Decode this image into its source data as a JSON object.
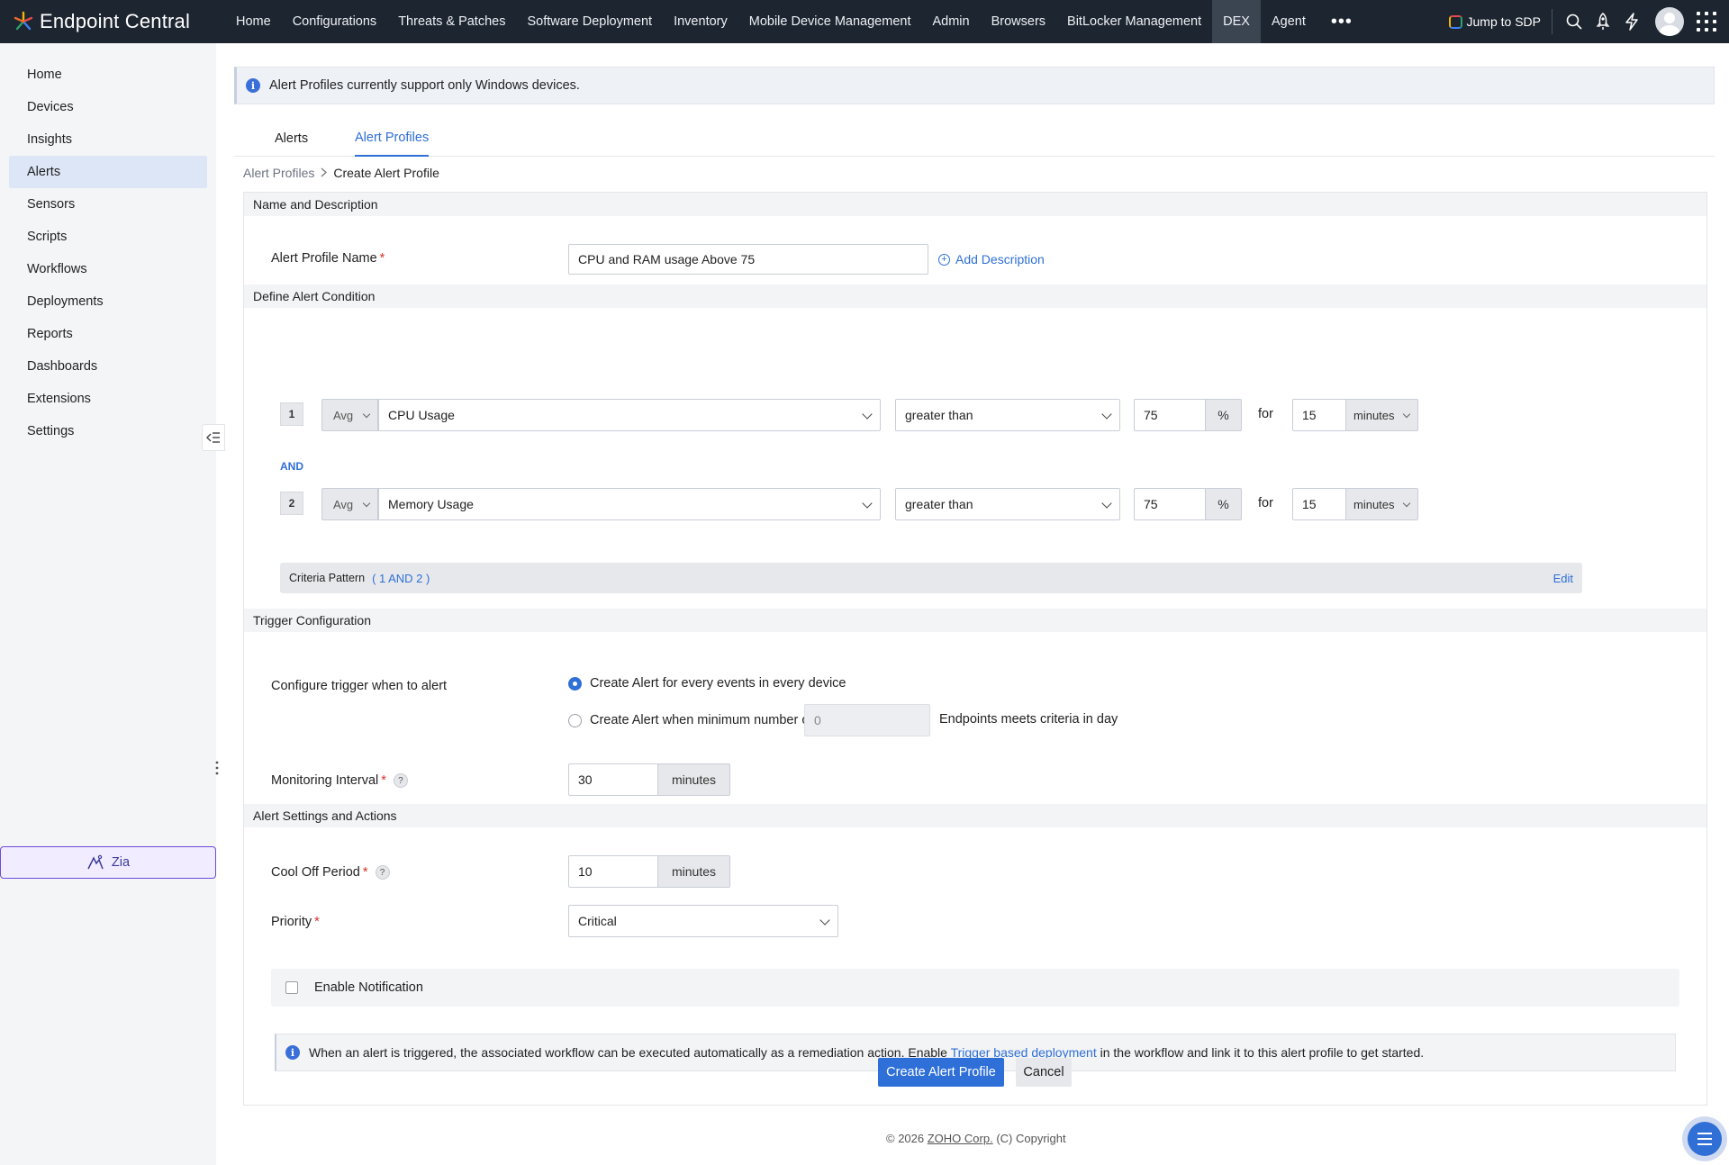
{
  "app": {
    "title": "Endpoint Central"
  },
  "topnav": {
    "items": [
      "Home",
      "Configurations",
      "Threats & Patches",
      "Software Deployment",
      "Inventory",
      "Mobile Device Management",
      "Admin",
      "Browsers",
      "BitLocker Management",
      "DEX",
      "Agent"
    ],
    "active": "DEX",
    "more": "•••",
    "jump_label": "Jump to SDP",
    "icons": [
      "search-icon",
      "rocket-icon",
      "lightning-icon",
      "avatar",
      "app-grid-icon"
    ]
  },
  "sidebar": {
    "items": [
      "Home",
      "Devices",
      "Insights",
      "Alerts",
      "Sensors",
      "Scripts",
      "Workflows",
      "Deployments",
      "Reports",
      "Dashboards",
      "Extensions",
      "Settings"
    ],
    "active": "Alerts",
    "zia_label": "Zia"
  },
  "banner": {
    "text": "Alert Profiles currently support only Windows devices."
  },
  "tabs": {
    "alerts": "Alerts",
    "alert_profiles": "Alert Profiles",
    "active": "Alert Profiles"
  },
  "breadcrumb": {
    "parent": "Alert Profiles",
    "current": "Create Alert Profile"
  },
  "sections": {
    "name": "Name and Description",
    "condition": "Define Alert Condition",
    "trigger": "Trigger Configuration",
    "settings": "Alert Settings and Actions"
  },
  "name_section": {
    "label": "Alert Profile Name",
    "value": "CPU and RAM usage Above 75",
    "add_description": "Add Description"
  },
  "conditions": [
    {
      "num": "1",
      "agg": "Avg",
      "metric": "CPU Usage",
      "operator": "greater than",
      "value": "75",
      "unit": "%",
      "for": "for",
      "duration": "15",
      "duration_unit": "minutes"
    },
    {
      "num": "2",
      "agg": "Avg",
      "metric": "Memory Usage",
      "operator": "greater than",
      "value": "75",
      "unit": "%",
      "for": "for",
      "duration": "15",
      "duration_unit": "minutes"
    }
  ],
  "and_label": "AND",
  "criteria": {
    "label": "Criteria Pattern",
    "pattern": "( 1 AND 2 )",
    "edit": "Edit"
  },
  "trigger": {
    "label": "Configure trigger when to alert",
    "option1": "Create Alert for every events in every device",
    "option2_prefix": "Create Alert when minimum number of",
    "option2_value": "0",
    "option2_suffix": "Endpoints meets criteria in day",
    "selected": "option1",
    "interval_label": "Monitoring Interval",
    "interval_value": "30",
    "interval_unit": "minutes"
  },
  "settings": {
    "cooloff_label": "Cool Off Period",
    "cooloff_value": "10",
    "cooloff_unit": "minutes",
    "priority_label": "Priority",
    "priority_value": "Critical",
    "notification_label": "Enable Notification",
    "notification_checked": false
  },
  "workflow_note": {
    "before": "When an alert is triggered, the associated workflow can be executed automatically as a remediation action. Enable ",
    "link": "Trigger based deployment",
    "after": " in the workflow and link it to this alert profile to get started."
  },
  "buttons": {
    "create": "Create Alert Profile",
    "cancel": "Cancel"
  },
  "footer": {
    "prefix": "© 2026 ",
    "link": "ZOHO Corp.",
    "suffix": " (C) Copyright"
  },
  "colors": {
    "topbar": "#1d2530",
    "accent": "#2f6fd6",
    "required": "#d93025",
    "sidebar_active": "#dde6f7"
  }
}
